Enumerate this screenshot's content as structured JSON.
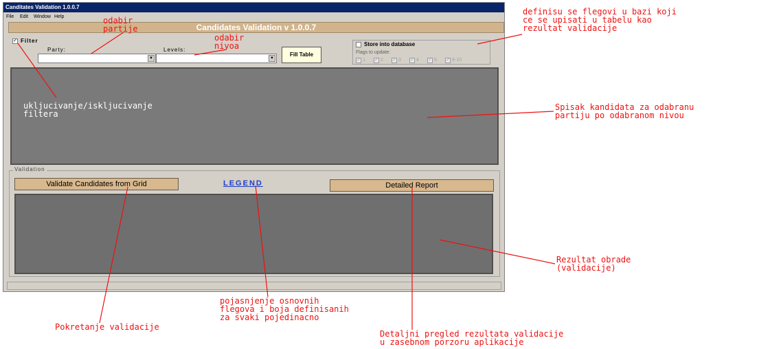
{
  "window": {
    "title": "Canditates Validation 1.0.0.7",
    "menu": [
      "File",
      "Edit",
      "Window",
      "Help"
    ],
    "banner": "Candidates Validation v 1.0.0.7"
  },
  "filter": {
    "checkbox_label": "Filter",
    "checked": true,
    "party_label": "Party:",
    "party_value": "",
    "levels_label": "Levels:",
    "levels_value": "",
    "fill_table_label": "Fill Table"
  },
  "store": {
    "checkbox_label": "Store into database",
    "checked": false,
    "flags_label": "Flags to update:",
    "flags": [
      "1",
      "2",
      "3",
      "4",
      "5",
      "6-10"
    ]
  },
  "validation": {
    "group_label": "Validation",
    "validate_button": "Validate Candidates from Grid",
    "legend_link": "LEGEND",
    "detailed_button": "Detailed Report"
  },
  "annotations": {
    "party": "odabir\npartije",
    "levels": "odabir\nnivoa",
    "flags": "definisu se flegovi u bazi koji\nce se upisati u tabelu kao\nrezultat validacije",
    "filter_toggle": "ukljucivanje/iskljucivanje\nfiltera",
    "candidate_list": "Spisak kandidata za odabranu\npartiju po odabranom nivou",
    "result": "Rezultat obrade\n(validacije)",
    "legend_explain": "pojasnjenje osnovnih\nflegova i boja definisanih\nza svaki pojedinacno",
    "start_validation": "Pokretanje validacije",
    "detailed_explain": "Detaljni pregled rezultata validacije\nu zasebnom porzoru aplikacije"
  },
  "colors": {
    "annotation": "#ee1111",
    "banner": "#d2b48c",
    "button": "#d8b88e",
    "grid": "#7a7a7a",
    "legend_link": "#1a3ccc"
  }
}
